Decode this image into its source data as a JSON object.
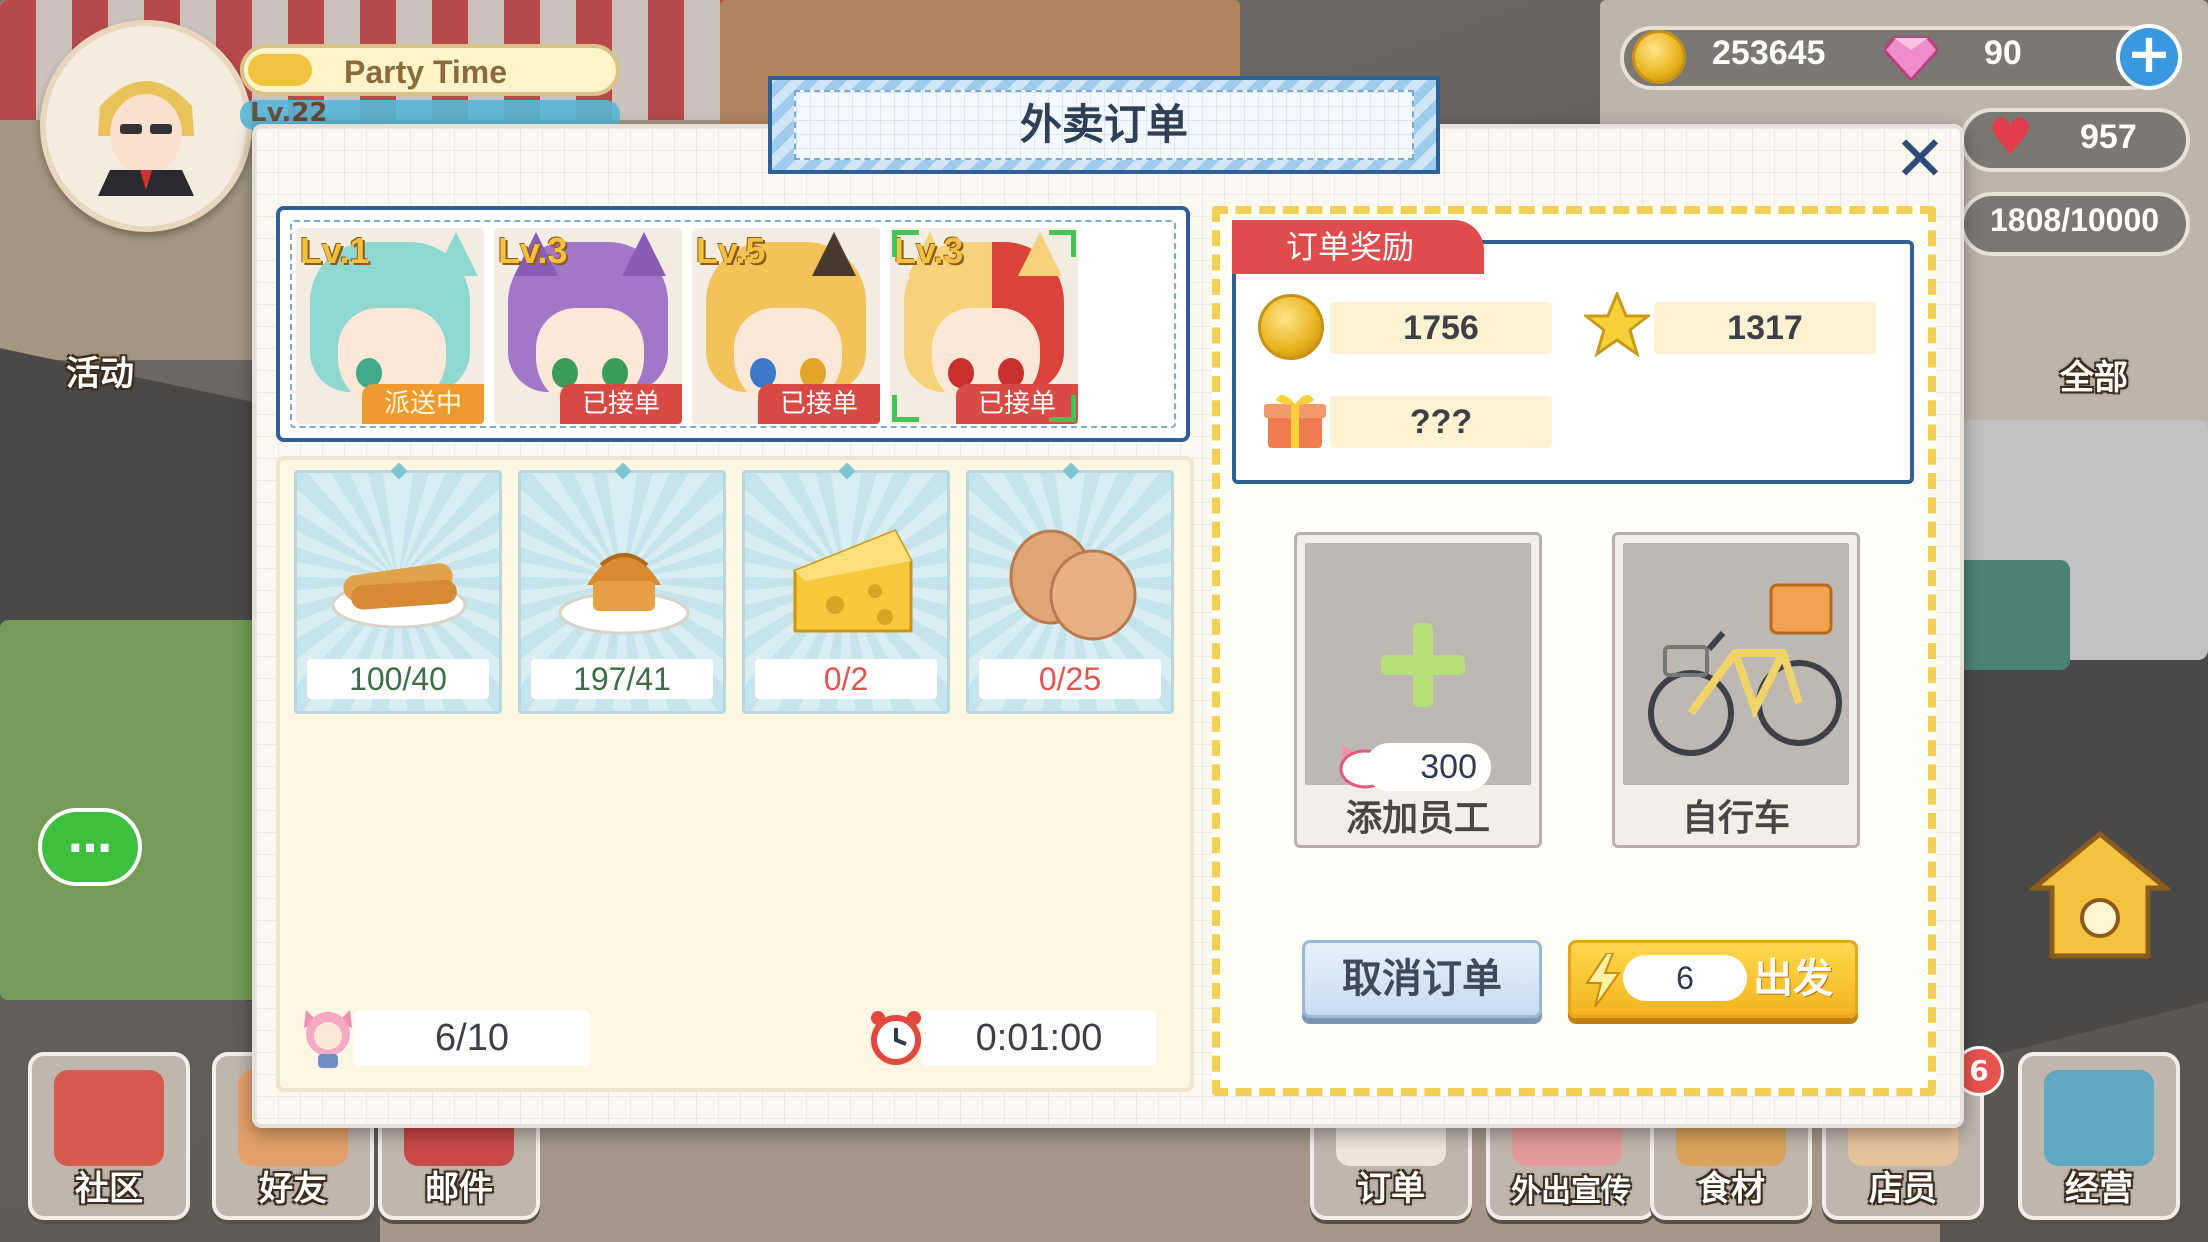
{
  "profile": {
    "title": "Party Time",
    "level_text": "Lv.22"
  },
  "currency": {
    "gold": "253645",
    "gems": "90",
    "hearts": "957",
    "capacity": "1808/10000"
  },
  "side": {
    "activity_label": "活动",
    "all_label": "全部"
  },
  "modal": {
    "title": "外卖订单",
    "close_symbol": "✕",
    "couriers": [
      {
        "level": "Lv.1",
        "status": "派送中"
      },
      {
        "level": "Lv.3",
        "status": "已接单"
      },
      {
        "level": "Lv.5",
        "status": "已接单"
      },
      {
        "level": "Lv.3",
        "status": "已接单"
      }
    ],
    "ingredients": [
      {
        "icon": "baguette-icon",
        "count": "100/40",
        "enough": true
      },
      {
        "icon": "muffin-icon",
        "count": "197/41",
        "enough": true
      },
      {
        "icon": "cheese-icon",
        "count": "0/2",
        "enough": false
      },
      {
        "icon": "eggs-icon",
        "count": "0/25",
        "enough": false
      }
    ],
    "staff_count": "6/10",
    "timer": "0:01:00",
    "reward_title": "订单奖励",
    "rewards": {
      "gold": "1756",
      "stars": "1317",
      "gift": "???"
    },
    "add_staff": {
      "cost": "300",
      "label": "添加员工"
    },
    "vehicle": {
      "label": "自行车"
    },
    "cancel_label": "取消订单",
    "go_count": "6",
    "go_label": "出发"
  },
  "nav": {
    "left": [
      {
        "label": "社区",
        "icon": "community-icon"
      },
      {
        "label": "好友",
        "icon": "friends-icon"
      },
      {
        "label": "邮件",
        "icon": "mail-icon"
      }
    ],
    "right": [
      {
        "label": "订单",
        "icon": "order-icon"
      },
      {
        "label": "外出宣传",
        "icon": "promotion-icon"
      },
      {
        "label": "食材",
        "icon": "ingredients-icon"
      },
      {
        "label": "店员",
        "icon": "staff-icon"
      },
      {
        "label": "经营",
        "icon": "business-icon"
      }
    ],
    "badge": "6"
  },
  "colors": {
    "accent_blue": "#2f5f94",
    "reward_red": "#de4c4d",
    "go_yellow": "#f3b420",
    "lack_red": "#e2534c",
    "ok_green": "#3d6e46"
  }
}
